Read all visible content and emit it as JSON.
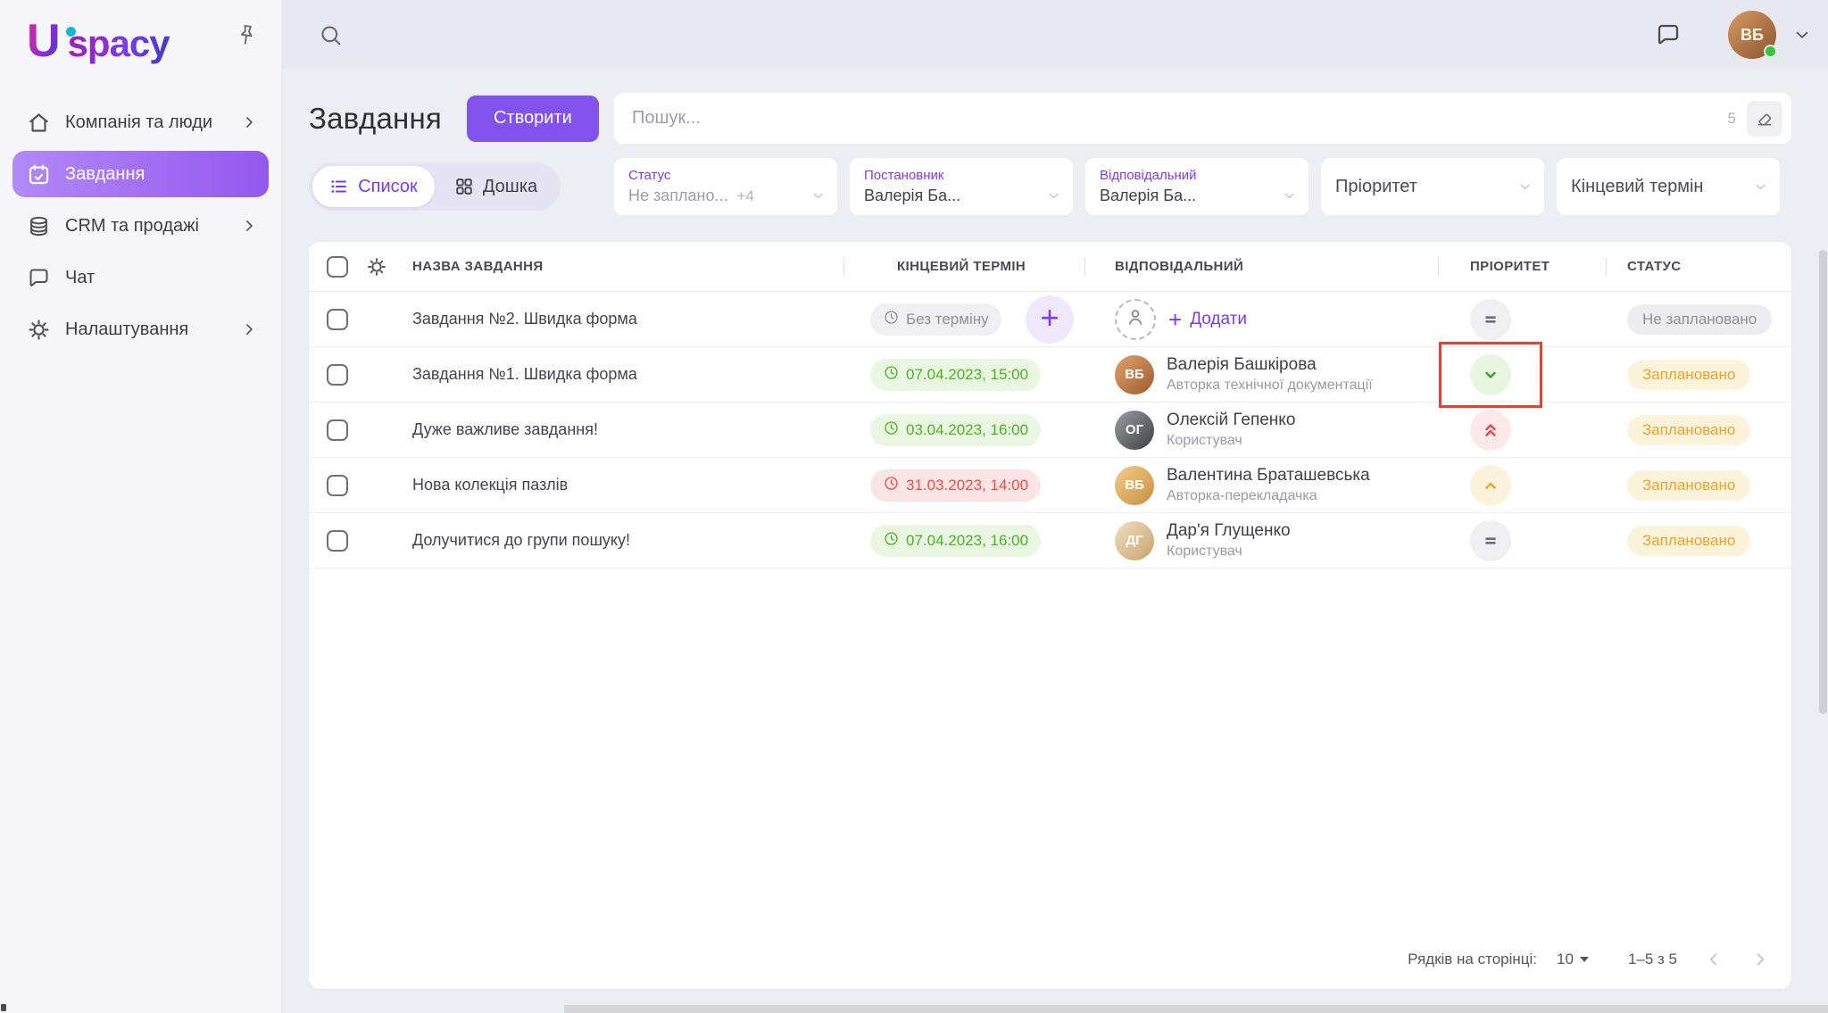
{
  "sidebar": {
    "logo_mark": "U",
    "logo_text": "spacy",
    "items": [
      {
        "id": "company",
        "label": "Компанія та люди",
        "icon": "home-icon",
        "chevron": true,
        "active": false
      },
      {
        "id": "tasks",
        "label": "Завдання",
        "icon": "calendar-icon",
        "chevron": false,
        "active": true
      },
      {
        "id": "crm",
        "label": "CRM та продажі",
        "icon": "database-icon",
        "chevron": true,
        "active": false
      },
      {
        "id": "chat",
        "label": "Чат",
        "icon": "chat-icon",
        "chevron": false,
        "active": false
      },
      {
        "id": "settings",
        "label": "Налаштування",
        "icon": "gear-icon",
        "chevron": true,
        "active": false
      }
    ]
  },
  "topbar": {
    "user_initials": "ВБ",
    "user_status": "online"
  },
  "header": {
    "title": "Завдання",
    "create_label": "Створити",
    "search_placeholder": "Пошук...",
    "result_count": "5"
  },
  "view_toggle": {
    "list_label": "Список",
    "board_label": "Дошка",
    "active": "list"
  },
  "filters": [
    {
      "name": "status",
      "label": "Статус",
      "value": "Не заплано...",
      "badge": "+4",
      "value_muted": true
    },
    {
      "name": "creator",
      "label": "Постановник",
      "value": "Валерія Ба..."
    },
    {
      "name": "responsible",
      "label": "Відповідальний",
      "value": "Валерія Ба..."
    },
    {
      "name": "priority",
      "label": "Пріоритет",
      "single": true
    },
    {
      "name": "deadline",
      "label": "Кінцевий термін",
      "single": true
    }
  ],
  "table": {
    "columns": {
      "name": "НАЗВА ЗАВДАННЯ",
      "deadline": "КІНЦЕВИЙ ТЕРМІН",
      "responsible": "ВІДПОВІДАЛЬНИЙ",
      "priority": "ПРІОРИТЕТ",
      "status": "СТАТУС"
    },
    "rows": [
      {
        "name": "Завдання №2. Швидка форма",
        "deadline": {
          "text": "Без терміну",
          "tone": "gray"
        },
        "quick_add": true,
        "responsible": {
          "add_label": "Додати",
          "placeholder": true
        },
        "priority": {
          "icon": "equals-icon",
          "tone": "gray"
        },
        "status": {
          "text": "Не заплановано",
          "tone": "gray"
        }
      },
      {
        "name": "Завдання №1. Швидка форма",
        "deadline": {
          "text": "07.04.2023, 15:00",
          "tone": "green"
        },
        "responsible": {
          "name": "Валерія Башкірова",
          "role": "Авторка технічної документації",
          "initials": "ВБ",
          "avatar_colors": [
            "#E3A26B",
            "#9C5B2E"
          ]
        },
        "priority": {
          "icon": "chevron-down-icon",
          "tone": "green",
          "highlighted": true
        },
        "status": {
          "text": "Заплановано",
          "tone": "yellow"
        }
      },
      {
        "name": "Дуже важливе завдання!",
        "deadline": {
          "text": "03.04.2023, 16:00",
          "tone": "green"
        },
        "responsible": {
          "name": "Олексій Гепенко",
          "role": "Користувач",
          "initials": "ОГ",
          "avatar_colors": [
            "#9C9CA4",
            "#3E3E44"
          ]
        },
        "priority": {
          "icon": "double-chevron-up-icon",
          "tone": "red"
        },
        "status": {
          "text": "Заплановано",
          "tone": "yellow"
        }
      },
      {
        "name": "Нова колекція пазлів",
        "deadline": {
          "text": "31.03.2023, 14:00",
          "tone": "red"
        },
        "responsible": {
          "name": "Валентина Браташевська",
          "role": "Авторка-перекладачка",
          "initials": "ВБ",
          "avatar_colors": [
            "#F3CE8A",
            "#C98E3F"
          ]
        },
        "priority": {
          "icon": "chevron-up-icon",
          "tone": "yellow"
        },
        "status": {
          "text": "Заплановано",
          "tone": "yellow"
        }
      },
      {
        "name": "Долучитися до групи пошуку!",
        "deadline": {
          "text": "07.04.2023, 16:00",
          "tone": "green"
        },
        "responsible": {
          "name": "Дар'я Глущенко",
          "role": "Користувач",
          "initials": "ДГ",
          "avatar_colors": [
            "#F0DFC2",
            "#C9A26B"
          ]
        },
        "priority": {
          "icon": "equals-icon",
          "tone": "gray"
        },
        "status": {
          "text": "Заплановано",
          "tone": "yellow"
        }
      }
    ]
  },
  "footer": {
    "rows_label": "Рядків на сторінці:",
    "per_page": "10",
    "range": "1–5 з 5"
  },
  "colors": {
    "accent_purple": "#7C3AED",
    "create_button": "#8252EC",
    "active_nav_gradient": [
      "#B289F6",
      "#9458EF"
    ],
    "status_planned_bg": "#FCF3DB",
    "status_planned_text": "#EDA12F",
    "status_unplanned_bg": "#EDEDF1",
    "status_unplanned_text": "#8F8F98",
    "deadline_green": "#4DB424",
    "deadline_red": "#EF4B42",
    "priority_green": "#3FA52B",
    "priority_red": "#E2454F",
    "priority_yellow": "#EFA52F",
    "annotation_red": "#E8402B",
    "logo_dot": "#14B8D4",
    "online_dot": "#35C53A"
  }
}
